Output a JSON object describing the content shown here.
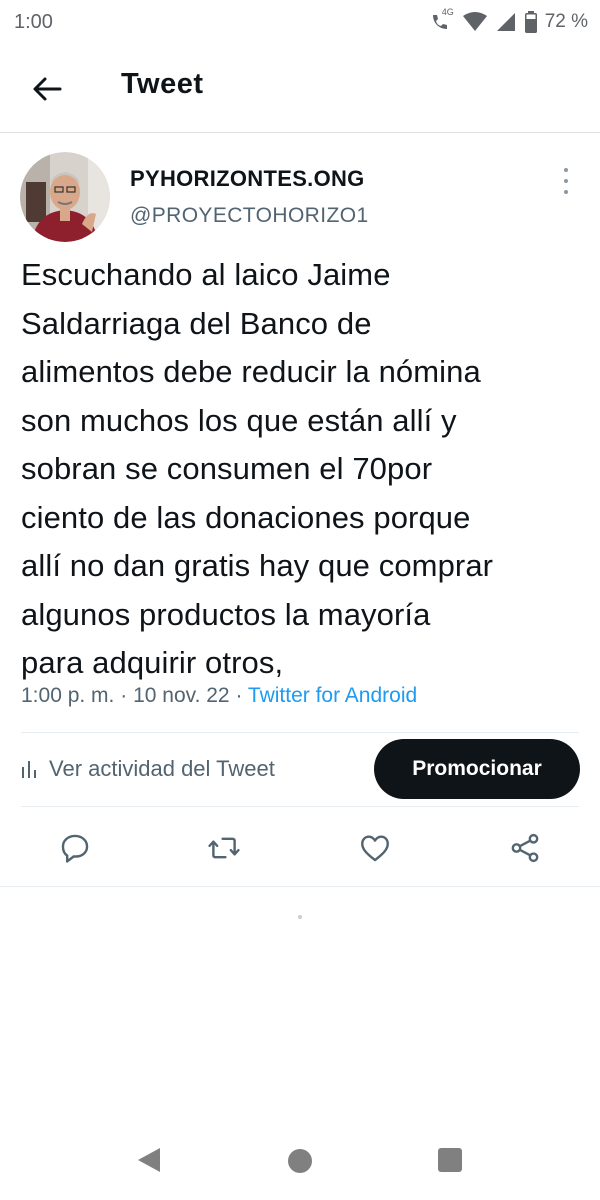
{
  "status_bar": {
    "time": "1:00",
    "network": "4G",
    "battery": "72 %",
    "icons": [
      "wifi-call-icon",
      "wifi-icon",
      "signal-icon",
      "battery-icon"
    ]
  },
  "header": {
    "title": "Tweet",
    "back_icon": "arrow-left-icon"
  },
  "tweet": {
    "author": {
      "display_name": "PYHORIZONTES.ONG",
      "handle": "@PROYECTOHORIZO1"
    },
    "text": "Escuchando al laico Jaime\nSaldarriaga del Banco de\nalimentos debe reducir la nómina\nson muchos los que están allí y\nsobran se consumen el 70por\nciento de las donaciones porque\nallí no dan gratis  hay que comprar\nalgunos productos la mayoría\npara adquirir otros,",
    "time": "1:00 p. m.",
    "separator": "·",
    "date": "10 nov. 22",
    "source": "Twitter for Android",
    "activity_label": "Ver actividad del Tweet",
    "promote_label": "Promocionar"
  },
  "actions": [
    "reply-icon",
    "retweet-icon",
    "like-icon",
    "share-icon"
  ],
  "colors": {
    "text": "#0f1419",
    "secondary": "#536471",
    "link": "#1d9bf0",
    "divider": "#e6ecf0",
    "button_bg": "#0f1419"
  }
}
